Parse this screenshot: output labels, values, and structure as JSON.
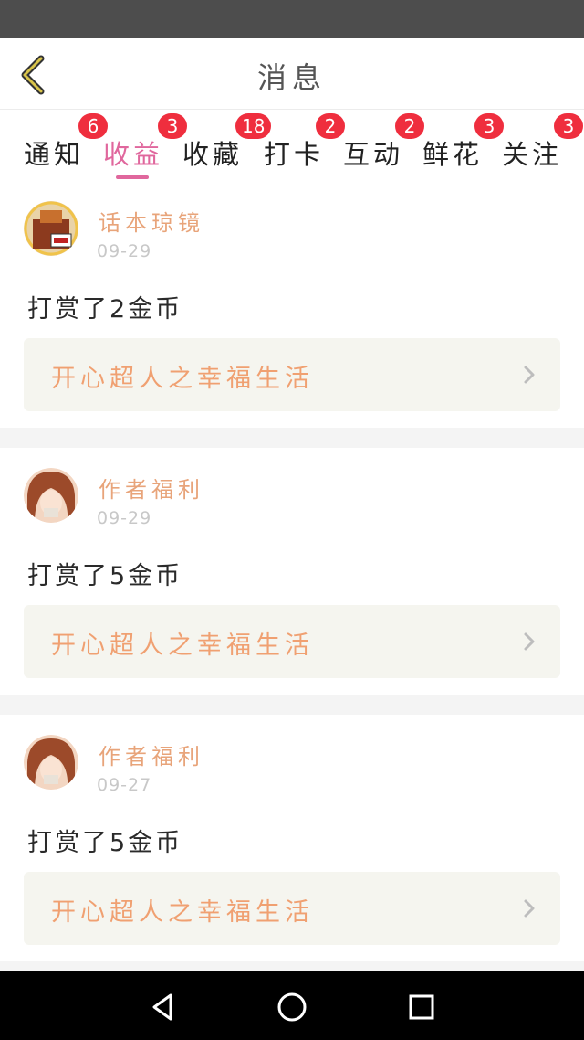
{
  "header": {
    "title": "消息",
    "back_icon": "chevron-left-icon",
    "accent_color": "#c9b23a"
  },
  "tabs": [
    {
      "label": "通知",
      "badge": "6",
      "active": false
    },
    {
      "label": "收益",
      "badge": "3",
      "active": true
    },
    {
      "label": "收藏",
      "badge": "18",
      "active": false
    },
    {
      "label": "打卡",
      "badge": "2",
      "active": false
    },
    {
      "label": "互动",
      "badge": "2",
      "active": false
    },
    {
      "label": "鲜花",
      "badge": "3",
      "active": false
    },
    {
      "label": "关注",
      "badge": "3",
      "active": false
    }
  ],
  "colors": {
    "active_tab": "#e0679d",
    "badge": "#ef2e3e",
    "username": "#e8a47a",
    "book_title": "#f0a071"
  },
  "items": [
    {
      "user": "话本琼镜",
      "date": "09-29",
      "message": "打赏了2金币",
      "book_title": "开心超人之幸福生活",
      "avatar": "avatar-image"
    },
    {
      "user": "作者福利",
      "date": "09-29",
      "message": "打赏了5金币",
      "book_title": "开心超人之幸福生活",
      "avatar": "avatar-image"
    },
    {
      "user": "作者福利",
      "date": "09-27",
      "message": "打赏了5金币",
      "book_title": "开心超人之幸福生活",
      "avatar": "avatar-image"
    }
  ],
  "navbar": {
    "back_icon": "triangle-back-icon",
    "home_icon": "circle-home-icon",
    "recents_icon": "square-recents-icon"
  }
}
